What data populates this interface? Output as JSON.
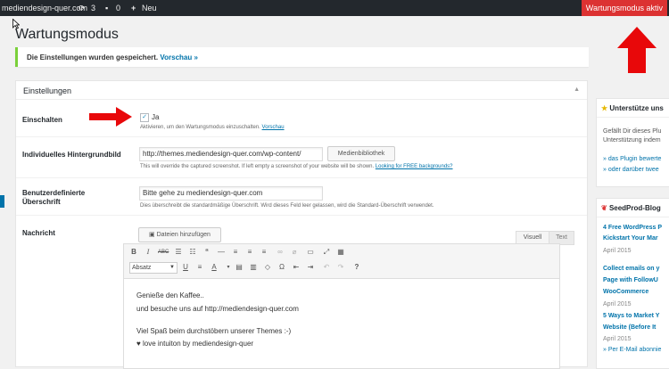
{
  "adminbar": {
    "site_name": "mediendesign-quer.com",
    "updates_count": "3",
    "comments_count": "0",
    "new_label": "Neu",
    "maintenance_badge": "Wartungsmodus aktiv"
  },
  "page": {
    "title": "Wartungsmodus",
    "notice_text": "Die Einstellungen wurden gespeichert.",
    "notice_link": "Vorschau »"
  },
  "settings": {
    "box_title": "Einstellungen",
    "enable": {
      "label": "Einschalten",
      "checkbox_label": "Ja",
      "checked": true,
      "desc": "Aktivieren, um den Wartungsmodus einzuschalten.",
      "desc_link": "Vorschau"
    },
    "background": {
      "label": "Individuelles Hintergrundbild",
      "value": "http://themes.mediendesign-quer.com/wp-content/",
      "button": "Medienbibliothek",
      "desc": "This will override the captured screenshot. If left empty a screenshot of your website will be shown.",
      "desc_link": "Looking for FREE backgrounds?"
    },
    "headline": {
      "label_line1": "Benutzerdefinierte",
      "label_line2": "Überschrift",
      "value": "Bitte gehe zu mediendesign-quer.com",
      "desc": "Dies überschreibt die standardmäßige Überschrift. Wird dieses Feld leer gelassen, wird die Standard-Überschrift verwendet."
    },
    "message": {
      "label": "Nachricht",
      "add_media": "Dateien hinzufügen",
      "tab_visual": "Visuell",
      "tab_text": "Text",
      "format_select": "Absatz",
      "lines": [
        "Genieße den Kaffee..",
        "und besuche uns auf http://mediendesign-quer.com",
        "Viel Spaß beim durchstöbern unserer Themes :-)",
        "♥ love intuiton by mediendesign-quer"
      ]
    }
  },
  "sidebar": {
    "support": {
      "title": "Unterstütze uns",
      "text_line1": "Gefällt Dir dieses Plu",
      "text_line2": "Unterstützung indem",
      "link1": "» das Plugin bewerte",
      "link2": "» oder darüber twee"
    },
    "blog": {
      "title": "SeedProd-Blog",
      "posts": [
        {
          "line1": "4 Free WordPress P",
          "line2": "Kickstart Your Mar",
          "date": "April 2015"
        },
        {
          "line1": "Collect emails on y",
          "line2": "Page with FollowU",
          "line3": "WooCommerce",
          "date": "April 2015"
        },
        {
          "line1": "5 Ways to Market Y",
          "line2": "Website (Before It",
          "date": "April 2015"
        }
      ],
      "email_link": "» Per E-Mail abonnie"
    }
  },
  "icons": [
    "updates-icon",
    "comments-icon",
    "plus-icon",
    "star-icon",
    "seedprod-icon",
    "add-media-icon"
  ],
  "colors": {
    "admin_bar": "#23282d",
    "badge": "#dc3232",
    "notice_border": "#7ad03a",
    "link": "#0073aa",
    "arrow": "#e8080a"
  }
}
